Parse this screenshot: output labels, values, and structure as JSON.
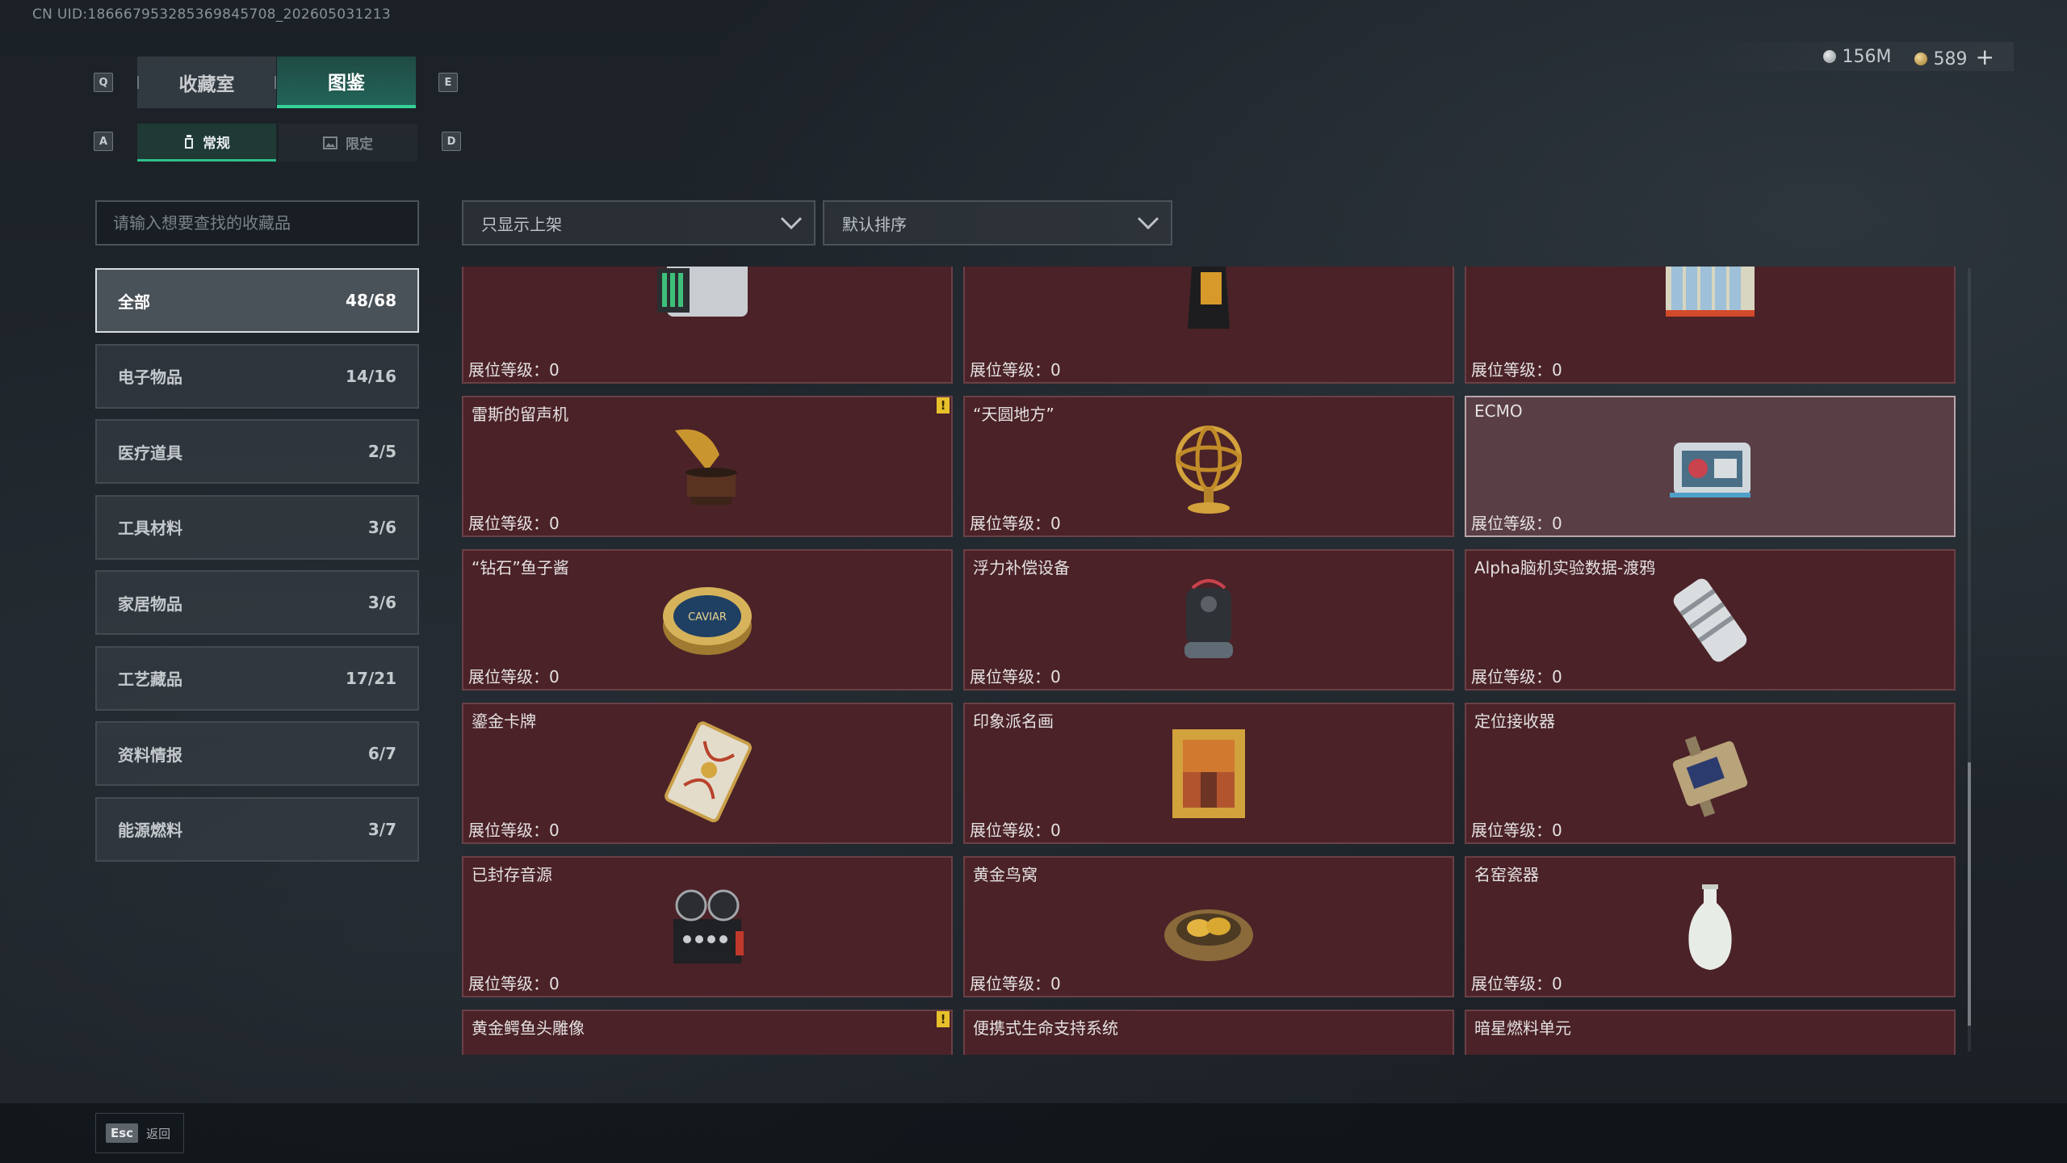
{
  "uid_text": "CN UID:1866679532853698457​08_202605031213",
  "tabs": {
    "key_left": "Q",
    "key_right": "E",
    "items": [
      "收藏室",
      "图鉴"
    ],
    "active": 1
  },
  "subtabs": {
    "key_left": "A",
    "key_right": "D",
    "items": [
      "常规",
      "限定"
    ],
    "active": 0
  },
  "currency": {
    "silver": "156M",
    "gold": "589",
    "add_label": "+"
  },
  "search": {
    "placeholder": "请输入想要查找的收藏品"
  },
  "filters": {
    "shelf": "只显示上架",
    "sort": "默认排序"
  },
  "categories": [
    {
      "label": "全部",
      "count": "48/68"
    },
    {
      "label": "电子物品",
      "count": "14/16"
    },
    {
      "label": "医疗道具",
      "count": "2/5"
    },
    {
      "label": "工具材料",
      "count": "3/6"
    },
    {
      "label": "家居物品",
      "count": "3/6"
    },
    {
      "label": "工艺藏品",
      "count": "17/21"
    },
    {
      "label": "资料情报",
      "count": "6/7"
    },
    {
      "label": "能源燃料",
      "count": "3/7"
    }
  ],
  "level_label": "展位等级：0",
  "items": [
    {
      "name": "",
      "icon": "server-unit-icon"
    },
    {
      "name": "",
      "icon": "coffee-bag-icon"
    },
    {
      "name": "",
      "icon": "battery-pack-icon"
    },
    {
      "name": "雷斯的留声机",
      "icon": "gramophone-icon",
      "warn": "!"
    },
    {
      "name": "“天圆地方”",
      "icon": "armillary-sphere-icon"
    },
    {
      "name": "ECMO",
      "icon": "ecmo-machine-icon"
    },
    {
      "name": "“钻石”鱼子酱",
      "icon": "caviar-tin-icon",
      "tin_text": "CAVIAR"
    },
    {
      "name": "浮力补偿设备",
      "icon": "buoyancy-device-icon"
    },
    {
      "name": "Alpha脑机实验数据-渡鸦",
      "icon": "data-canister-icon"
    },
    {
      "name": "鎏金卡牌",
      "icon": "gilded-card-icon"
    },
    {
      "name": "印象派名画",
      "icon": "framed-painting-icon"
    },
    {
      "name": "定位接收器",
      "icon": "locator-receiver-icon"
    },
    {
      "name": "已封存音源",
      "icon": "reel-recorder-icon"
    },
    {
      "name": "黄金鸟窝",
      "icon": "golden-nest-icon"
    },
    {
      "name": "名窑瓷器",
      "icon": "porcelain-vase-icon"
    },
    {
      "name": "黄金鳄鱼头雕像",
      "icon": "crocodile-statue-icon",
      "warn": "!"
    },
    {
      "name": "便携式生命支持系统",
      "icon": "life-support-icon"
    },
    {
      "name": "暗星燃料单元",
      "icon": "fuel-cell-icon"
    }
  ],
  "footer": {
    "key": "Esc",
    "label": "返回"
  },
  "colors": {
    "accent": "#35d39a",
    "card_bg": "#4a2227",
    "selected_card_bg": "#5a3e45",
    "warn": "#e7c02c"
  }
}
